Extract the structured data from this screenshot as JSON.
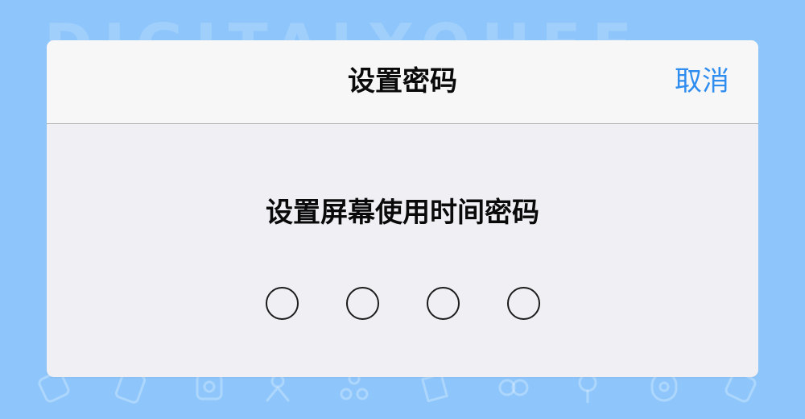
{
  "dialog": {
    "title": "设置密码",
    "cancel_label": "取消",
    "prompt": "设置屏幕使用时间密码",
    "passcode": {
      "length": 4,
      "entered": 0
    }
  },
  "colors": {
    "background": "#8ec6fb",
    "dialog_background": "#f0eff4",
    "nav_background": "#f7f7f7",
    "accent": "#2f8df0",
    "text": "#0a0a0a"
  }
}
